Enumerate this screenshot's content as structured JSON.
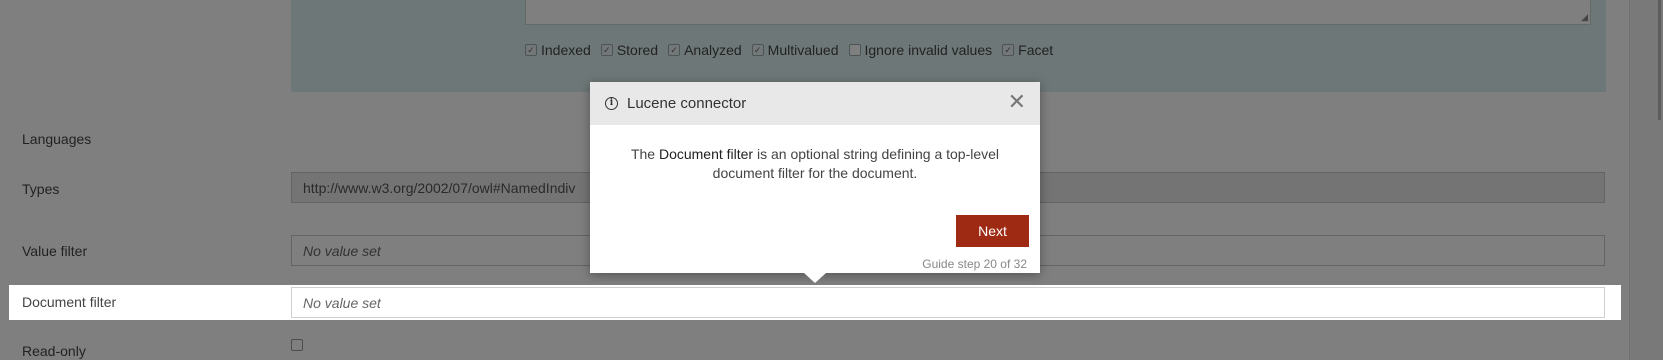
{
  "options": {
    "checkboxes": [
      {
        "label": "Indexed",
        "checked": true
      },
      {
        "label": "Stored",
        "checked": true
      },
      {
        "label": "Analyzed",
        "checked": true
      },
      {
        "label": "Multivalued",
        "checked": true
      },
      {
        "label": "Ignore invalid values",
        "checked": false
      },
      {
        "label": "Facet",
        "checked": true
      }
    ]
  },
  "rows": {
    "languages_label": "Languages",
    "types_label": "Types",
    "types_value": "http://www.w3.org/2002/07/owl#NamedIndiv",
    "value_filter_label": "Value filter",
    "value_filter_value": "No value set",
    "document_filter_label": "Document filter",
    "document_filter_value": "No value set",
    "readonly_label": "Read-only"
  },
  "dialog": {
    "title": "Lucene connector",
    "body_pre": "The ",
    "body_emph": "Document filter",
    "body_post": " is an optional string defining a top-level document filter for the document.",
    "next_label": "Next",
    "step_text": "Guide step 20 of 32",
    "close_symbol": "✕",
    "info_symbol": "i"
  },
  "colors": {
    "accent_button": "#9e2a14",
    "teal_panel": "#dcefef"
  }
}
